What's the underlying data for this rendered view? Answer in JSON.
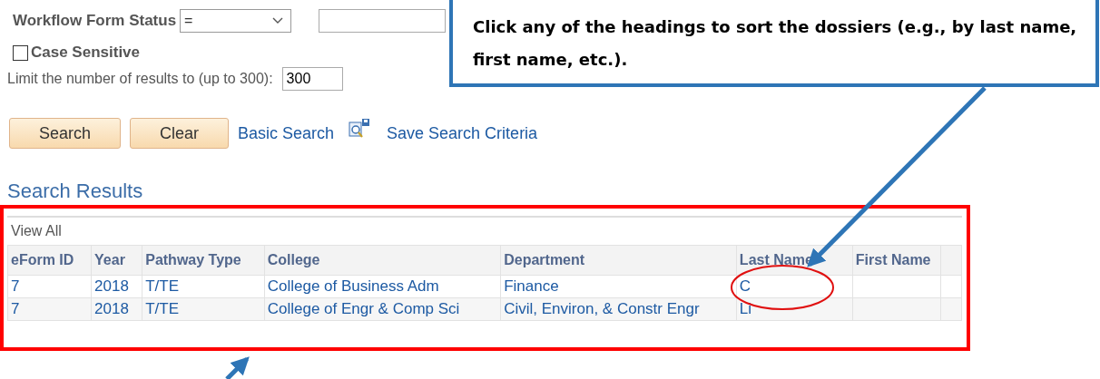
{
  "filter": {
    "label": "Workflow Form Status",
    "operator": "="
  },
  "case_sensitive": {
    "label": "Case Sensitive",
    "checked": false
  },
  "limit": {
    "label": "Limit the number of results to (up to 300):",
    "value": "300"
  },
  "buttons": [
    "Search",
    "Clear"
  ],
  "links": [
    {
      "label": "Basic Search",
      "kind": "link"
    },
    {
      "label": "Save Search Criteria",
      "kind": "icon-link"
    }
  ],
  "results": {
    "title": "Search Results",
    "view_all": "View All",
    "columns": [
      "eForm ID",
      "Year",
      "Pathway Type",
      "College",
      "Department",
      "Last Name",
      "First Name"
    ],
    "rows": [
      {
        "cells": [
          "7",
          "2018",
          "T/TE",
          "College of Business Adm",
          "Finance",
          "C",
          ""
        ]
      },
      {
        "cells": [
          "7",
          "2018",
          "T/TE",
          "College of Engr & Comp Sci",
          "Civil, Environ, & Constr Engr",
          "Li",
          ""
        ]
      }
    ]
  },
  "callout": {
    "text": "Click any of the headings to sort the dossiers (e.g., by last name, first name, etc.)."
  }
}
